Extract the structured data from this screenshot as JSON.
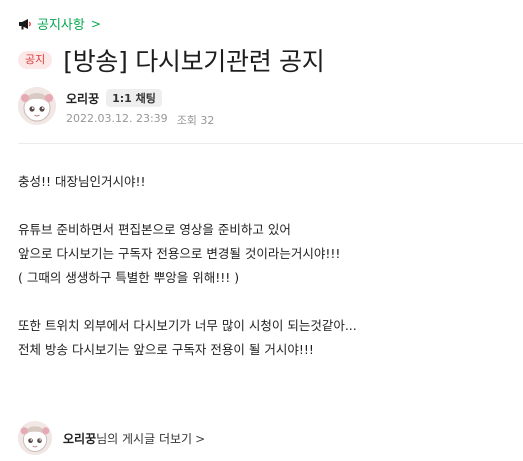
{
  "board": {
    "label": "공지사항",
    "icon": "megaphone-icon",
    "chevron": ">"
  },
  "post": {
    "badge": "공지",
    "title": "[방송] 다시보기관련 공지"
  },
  "author": {
    "nickname": "오리꿍",
    "chat_label": "1:1 채팅",
    "date": "2022.03.12. 23:39",
    "views_label": "조회 32"
  },
  "body": {
    "lines": [
      "충성!! 대장님인거시야!!",
      "",
      "유튜브 준비하면서 편집본으로 영상을 준비하고 있어",
      "앞으로 다시보기는 구독자 전용으로 변경될 것이라는거시야!!!",
      "( 그때의 생생하구 특별한 뿌앙을 위해!!! )",
      "",
      "또한 트위치 외부에서 다시보기가 너무 많이 시청이 되는것같아...",
      "전체 방송 다시보기는 앞으로 구독자 전용이 될 거시야!!!"
    ]
  },
  "footer": {
    "nickname": "오리꿍",
    "suffix": "님의 게시글 더보기",
    "chevron": ">"
  },
  "colors": {
    "accent_green": "#03a94d",
    "badge_bg": "#fde8e8",
    "badge_text": "#e03a3a",
    "meta_gray": "#979797"
  }
}
